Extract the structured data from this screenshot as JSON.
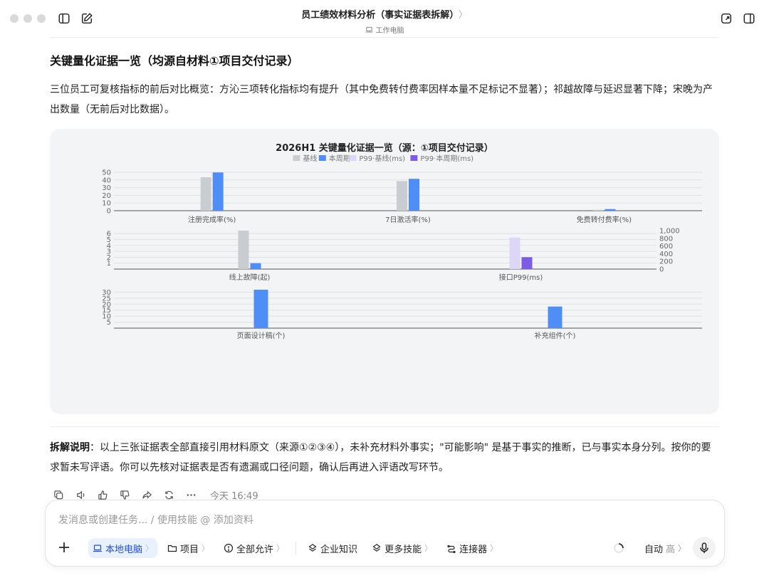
{
  "window": {
    "title": "员工绩效材料分析（事实证据表拆解）",
    "title_chevron": "〉",
    "subtitle": "工作电脑"
  },
  "content": {
    "heading": "关键量化证据一览（均源自材料①项目交付记录）",
    "paragraph": "三位员工可复核指标的前后对比概览：方沁三项转化指标均有提升（其中免费转付费率因样本量不足标记不显著）；祁越故障与延迟显著下降；宋晚为产出数量（无前后对比数据）。",
    "explain_label": "拆解说明",
    "explain_text": "：以上三张证据表全部直接引用材料原文（来源①②③④），未补充材料外事实；\"可能影响\" 是基于事实的推断，已与事实本身分列。按你的要求暂未写评语。你可以先核对证据表是否有遗漏或口径问题，确认后再进入评语改写环节。",
    "timestamp": "今天 16:49"
  },
  "chart_data": {
    "type": "bar",
    "title": "2026H1 关键量化证据一览（源：①项目交付记录）",
    "legend": [
      {
        "name": "基线",
        "color": "#c9ccd1"
      },
      {
        "name": "本周期",
        "color": "#4f8ef7"
      },
      {
        "name": "P99·基线(ms)",
        "color": "#ddd6f7"
      },
      {
        "name": "P99·本周期(ms)",
        "color": "#7c5ce6"
      }
    ],
    "legend_position": "top",
    "panels": [
      {
        "ylim": [
          0,
          50
        ],
        "yticks": [
          0,
          10,
          20,
          30,
          40,
          50
        ],
        "categories": [
          "注册完成率(%)",
          "7日激活率(%)",
          "免费转付费率(%)"
        ],
        "series": [
          {
            "name": "基线",
            "values": [
              43.5,
              38.5,
              1.2
            ]
          },
          {
            "name": "本周期",
            "values": [
              49.8,
              41.5,
              2.1
            ]
          }
        ]
      },
      {
        "ylim": [
          0,
          6.5
        ],
        "yticks": [
          1,
          2,
          3,
          4,
          5,
          6
        ],
        "y2lim": [
          0,
          1000
        ],
        "y2ticks": [
          "0",
          "200",
          "400",
          "600",
          "800",
          "1,000"
        ],
        "categories": [
          "线上故障(起)",
          "接口P99(ms)"
        ],
        "series": [
          {
            "name": "基线",
            "values": [
              6.5,
              null
            ]
          },
          {
            "name": "本周期",
            "values": [
              1,
              null
            ]
          },
          {
            "name": "P99·基线(ms)",
            "values": [
              null,
              820
            ]
          },
          {
            "name": "P99·本周期(ms)",
            "values": [
              null,
              310
            ]
          }
        ]
      },
      {
        "ylim": [
          0,
          32
        ],
        "yticks": [
          5,
          10,
          15,
          20,
          25,
          30
        ],
        "categories": [
          "页面设计稿(个)",
          "补充组件(个)"
        ],
        "series": [
          {
            "name": "本周期",
            "values": [
              32,
              18
            ]
          }
        ]
      }
    ]
  },
  "composer": {
    "placeholder": "发消息或创建任务... / 使用技能 @ 添加资料",
    "chips": [
      {
        "label": "本地电脑",
        "chevron": "〉"
      },
      {
        "label": "项目",
        "chevron": "〉"
      },
      {
        "label": "全部允许",
        "chevron": "〉"
      },
      {
        "label": "企业知识",
        "chevron": ""
      },
      {
        "label": "更多技能",
        "chevron": "〉"
      },
      {
        "label": "连接器",
        "chevron": "〉"
      }
    ],
    "mode_label": "自动",
    "mode_level": "高",
    "mode_chevron": "〉"
  },
  "colors": {
    "accent": "#1d4ed8",
    "bar_base": "#c9ccd1",
    "bar_current": "#4f8ef7",
    "p99_base": "#ddd6f7",
    "p99_current": "#7c5ce6"
  }
}
